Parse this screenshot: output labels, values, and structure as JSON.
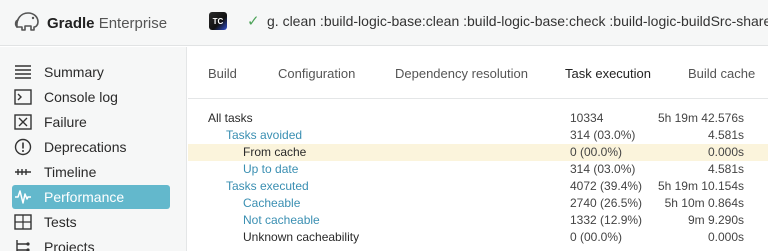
{
  "app": {
    "brand_bold": "Gradle",
    "brand_rest": " Enterprise",
    "ci_badge": "TC",
    "status_icon": "check-icon",
    "build_title": "g.  clean :build-logic-base:clean :build-logic-base:check :build-logic-buildSrc-shared"
  },
  "sidebar": {
    "items": [
      {
        "label": "Summary",
        "icon": "summary-icon"
      },
      {
        "label": "Console log",
        "icon": "console-log-icon"
      },
      {
        "label": "Failure",
        "icon": "failure-icon"
      },
      {
        "label": "Deprecations",
        "icon": "deprecations-icon"
      },
      {
        "label": "Timeline",
        "icon": "timeline-icon"
      },
      {
        "label": "Performance",
        "icon": "performance-icon",
        "active": true
      },
      {
        "label": "Tests",
        "icon": "tests-icon"
      },
      {
        "label": "Projects",
        "icon": "projects-icon"
      }
    ]
  },
  "tabs": [
    {
      "label": "Build"
    },
    {
      "label": "Configuration"
    },
    {
      "label": "Dependency resolution"
    },
    {
      "label": "Task execution",
      "active": true
    },
    {
      "label": "Build cache"
    }
  ],
  "task_table": {
    "rows": [
      {
        "name": "All tasks",
        "count": "10334",
        "time": "5h 19m 42.576s"
      },
      {
        "name": "Tasks avoided",
        "count": "314 (03.0%)",
        "time": "4.581s"
      },
      {
        "name": "From cache",
        "count": "0 (00.0%)",
        "time": "0.000s"
      },
      {
        "name": "Up to date",
        "count": "314 (03.0%)",
        "time": "4.581s"
      },
      {
        "name": "Tasks executed",
        "count": "4072 (39.4%)",
        "time": "5h 19m 10.154s"
      },
      {
        "name": "Cacheable",
        "count": "2740 (26.5%)",
        "time": "5h 10m 0.864s"
      },
      {
        "name": "Not cacheable",
        "count": "1332 (12.9%)",
        "time": "9m 9.290s"
      },
      {
        "name": "Unknown cacheability",
        "count": "0 (00.0%)",
        "time": "0.000s"
      }
    ]
  },
  "colors": {
    "accent": "#63b8cc",
    "link": "#3a8fb2",
    "highlight_row": "#fbf4dc",
    "success": "#4ea45a"
  }
}
